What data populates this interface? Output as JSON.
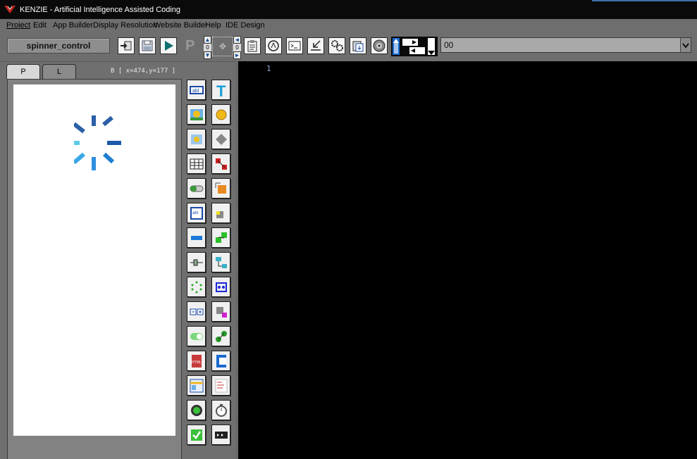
{
  "window": {
    "title": "KENZIE - Artificial Intelligence Assisted Coding",
    "brand_color": "#c8281e"
  },
  "menu": [
    {
      "label": "Project",
      "underline": "P"
    },
    {
      "label": "Edit",
      "underline": "E"
    },
    {
      "label": "App Builder"
    },
    {
      "label": "Display Resolution"
    },
    {
      "label": "Website Builder"
    },
    {
      "label": "Help",
      "underline": "H"
    },
    {
      "label": "IDE Design"
    }
  ],
  "toolbar": {
    "project_name": "spinner_control",
    "p_label": "P",
    "nudge_values": [
      "0",
      "0"
    ],
    "combo_value": "00"
  },
  "designer": {
    "tabs": [
      {
        "label": "P"
      },
      {
        "label": "L"
      }
    ],
    "coords": "B [ x=474,y=177 ]",
    "spinner_colors": [
      "#2b5fa8",
      "#1f7fd1",
      "#4fb8e6"
    ]
  },
  "editor": {
    "line_numbers": [
      "1"
    ]
  },
  "palette": {
    "tool_icons": [
      "textbox-icon",
      "text-label-icon",
      "image-icon",
      "round-button-icon",
      "image-swap-icon",
      "diamond-shape-icon",
      "grid-table-icon",
      "remove-link-icon",
      "progress-bar-icon",
      "resize-orange-icon",
      "multiline-text-icon",
      "move-yellow-icon",
      "button-blue-icon",
      "connect-green-icon",
      "slider-icon",
      "tree-node-icon",
      "spinner-dots-icon",
      "bounding-box-icon",
      "numeric-stepper-icon",
      "resize-pink-icon",
      "toggle-switch-icon",
      "link-green-icon",
      "html-file-icon",
      "pdf-export-icon",
      "window-layout-icon",
      "list-document-icon",
      "radio-button-icon",
      "stopwatch-icon",
      "checkbox-icon",
      "media-strip-icon"
    ]
  }
}
